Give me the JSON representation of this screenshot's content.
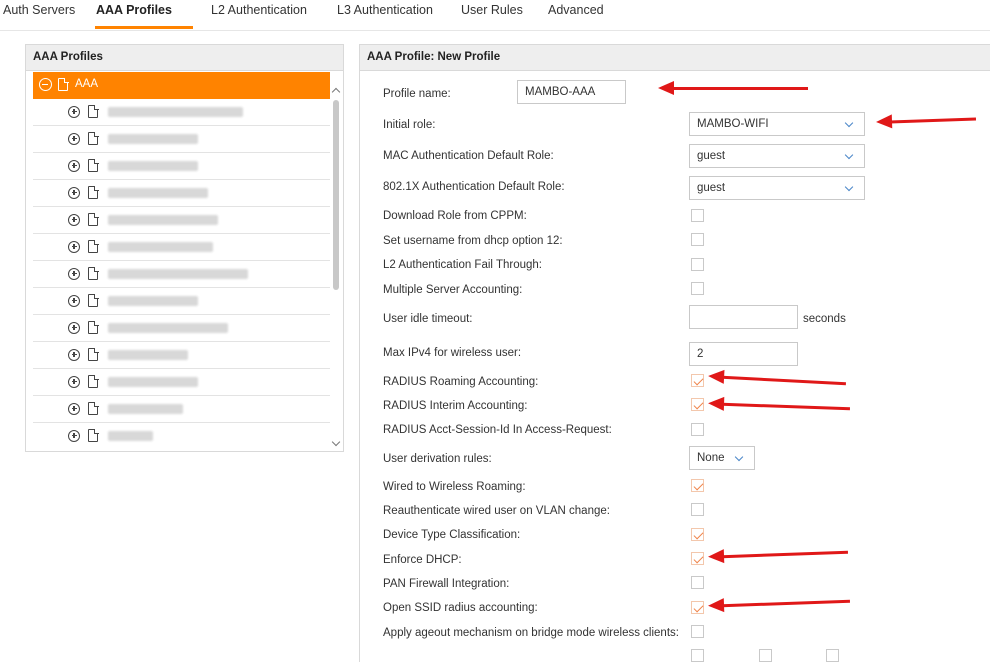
{
  "tabs": [
    {
      "label": "Auth Servers"
    },
    {
      "label": "AAA Profiles"
    },
    {
      "label": "L2 Authentication"
    },
    {
      "label": "L3 Authentication"
    },
    {
      "label": "User Rules"
    },
    {
      "label": "Advanced"
    }
  ],
  "active_tab": "AAA Profiles",
  "left_panel": {
    "title": "AAA Profiles",
    "root_label": "AAA",
    "child_count_visible": 13
  },
  "right_panel": {
    "title": "AAA Profile: New Profile",
    "profile_name": {
      "label": "Profile name:",
      "value": "MAMBO-AAA"
    },
    "initial_role": {
      "label": "Initial role:",
      "value": "MAMBO-WIFI"
    },
    "mac_role": {
      "label": "MAC Authentication Default Role:",
      "value": "guest"
    },
    "dot1x_role": {
      "label": "802.1X Authentication Default Role:",
      "value": "guest"
    },
    "download_role": {
      "label": "Download Role from CPPM:",
      "checked": false
    },
    "set_username": {
      "label": "Set username from dhcp option 12:",
      "checked": false
    },
    "l2_fail_through": {
      "label": "L2 Authentication Fail Through:",
      "checked": false
    },
    "multi_server_acct": {
      "label": "Multiple Server Accounting:",
      "checked": false
    },
    "idle_timeout": {
      "label": "User idle timeout:",
      "value": "",
      "unit": "seconds"
    },
    "max_ipv4": {
      "label": "Max IPv4 for wireless user:",
      "value": "2"
    },
    "radius_roaming": {
      "label": "RADIUS Roaming Accounting:",
      "checked": true
    },
    "radius_interim": {
      "label": "RADIUS Interim Accounting:",
      "checked": true
    },
    "acct_session_id": {
      "label": "RADIUS Acct-Session-Id In Access-Request:",
      "checked": false
    },
    "derivation_rules": {
      "label": "User derivation rules:",
      "value": "None"
    },
    "wired_roaming": {
      "label": "Wired to Wireless Roaming:",
      "checked": true
    },
    "reauth_wired": {
      "label": "Reauthenticate wired user on VLAN change:",
      "checked": false
    },
    "device_type": {
      "label": "Device Type Classification:",
      "checked": true
    },
    "enforce_dhcp": {
      "label": "Enforce DHCP:",
      "checked": true
    },
    "pan_firewall": {
      "label": "PAN Firewall Integration:",
      "checked": false
    },
    "open_ssid_acct": {
      "label": "Open SSID radius accounting:",
      "checked": true
    },
    "ageout": {
      "label": "Apply ageout mechanism on bridge mode wireless clients:",
      "checked": false
    }
  },
  "colors": {
    "accent": "#ff8300",
    "annotation_arrow": "#e01818",
    "checkmark": "#f0844a",
    "select_chevron": "#4a86c8"
  }
}
